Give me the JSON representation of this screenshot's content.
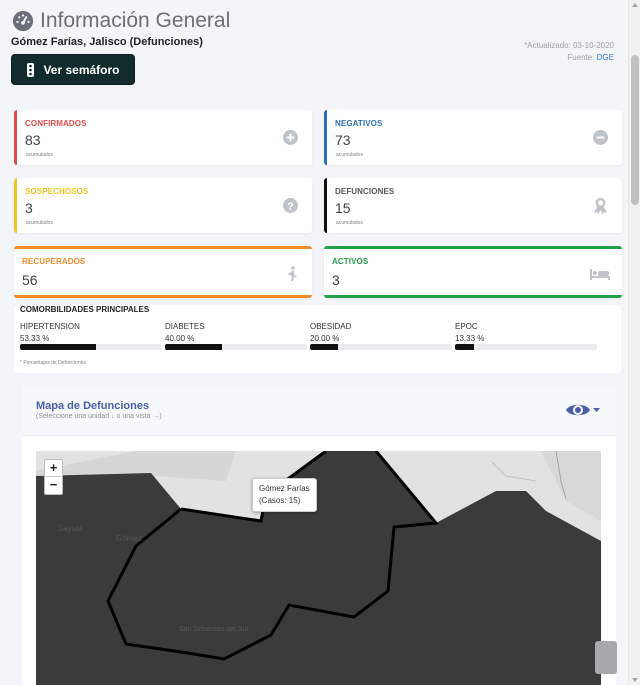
{
  "header": {
    "title": "Información General",
    "location": "Gómez Farías, Jalisco (Defunciones)",
    "updated_label": "*Actualizado: 03-10-2020",
    "source_prefix": "Fuente: ",
    "source_link": "DGE",
    "semaforo_button": "Ver semáforo"
  },
  "cards": {
    "confirmados": {
      "label": "CONFIRMADOS",
      "value": "83",
      "sub": "acumulados",
      "color": "#e24c4c"
    },
    "negativos": {
      "label": "NEGATIVOS",
      "value": "73",
      "sub": "acumulados",
      "color": "#2e6fb7"
    },
    "sospechosos": {
      "label": "SOSPECHOSOS",
      "value": "3",
      "sub": "acumulados",
      "color": "#f2c526"
    },
    "defunciones": {
      "label": "DEFUNCIONES",
      "value": "15",
      "sub": "acumulados",
      "color": "#111111"
    },
    "recuperados": {
      "label": "RECUPERADOS",
      "value": "56",
      "color": "#f28c28"
    },
    "activos": {
      "label": "ACTIVOS",
      "value": "3",
      "color": "#21a04a"
    }
  },
  "comorbilidades": {
    "title": "COMORBILIDADES PRINCIPALES",
    "note": "* Porcentajes de Defunciones",
    "items": [
      {
        "name": "HIPERTENSION",
        "percent": "53.33 %",
        "value": 53.33
      },
      {
        "name": "DIABETES",
        "percent": "40.00 %",
        "value": 40.0
      },
      {
        "name": "OBESIDAD",
        "percent": "20.00 %",
        "value": 20.0
      },
      {
        "name": "EPOC",
        "percent": "13.33 %",
        "value": 13.33
      }
    ]
  },
  "map": {
    "title": "Mapa de Defunciones",
    "subtitle": "(Seleccione una unidad ↓ o una vista →)",
    "zoom_in": "+",
    "zoom_out": "−",
    "tooltip_name": "Gómez Farías",
    "tooltip_cases": "(Casos: 15)",
    "place_labels": [
      "Sayula",
      "Gómez",
      "San Sebastián del Sur"
    ]
  },
  "colors": {
    "accent": "#4a5eab",
    "button_dark": "#122b2d"
  }
}
